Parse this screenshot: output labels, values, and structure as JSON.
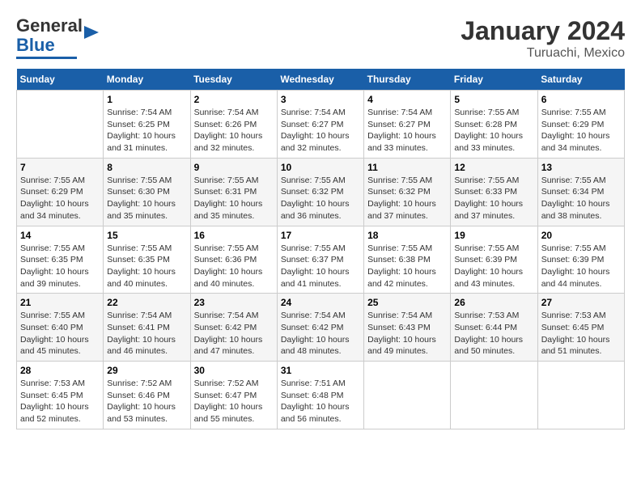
{
  "header": {
    "logo_line1": "General",
    "logo_line2": "Blue",
    "title": "January 2024",
    "subtitle": "Turuachi, Mexico"
  },
  "days_of_week": [
    "Sunday",
    "Monday",
    "Tuesday",
    "Wednesday",
    "Thursday",
    "Friday",
    "Saturday"
  ],
  "weeks": [
    [
      {
        "day": "",
        "info": ""
      },
      {
        "day": "1",
        "info": "Sunrise: 7:54 AM\nSunset: 6:25 PM\nDaylight: 10 hours\nand 31 minutes."
      },
      {
        "day": "2",
        "info": "Sunrise: 7:54 AM\nSunset: 6:26 PM\nDaylight: 10 hours\nand 32 minutes."
      },
      {
        "day": "3",
        "info": "Sunrise: 7:54 AM\nSunset: 6:27 PM\nDaylight: 10 hours\nand 32 minutes."
      },
      {
        "day": "4",
        "info": "Sunrise: 7:54 AM\nSunset: 6:27 PM\nDaylight: 10 hours\nand 33 minutes."
      },
      {
        "day": "5",
        "info": "Sunrise: 7:55 AM\nSunset: 6:28 PM\nDaylight: 10 hours\nand 33 minutes."
      },
      {
        "day": "6",
        "info": "Sunrise: 7:55 AM\nSunset: 6:29 PM\nDaylight: 10 hours\nand 34 minutes."
      }
    ],
    [
      {
        "day": "7",
        "info": "Sunrise: 7:55 AM\nSunset: 6:29 PM\nDaylight: 10 hours\nand 34 minutes."
      },
      {
        "day": "8",
        "info": "Sunrise: 7:55 AM\nSunset: 6:30 PM\nDaylight: 10 hours\nand 35 minutes."
      },
      {
        "day": "9",
        "info": "Sunrise: 7:55 AM\nSunset: 6:31 PM\nDaylight: 10 hours\nand 35 minutes."
      },
      {
        "day": "10",
        "info": "Sunrise: 7:55 AM\nSunset: 6:32 PM\nDaylight: 10 hours\nand 36 minutes."
      },
      {
        "day": "11",
        "info": "Sunrise: 7:55 AM\nSunset: 6:32 PM\nDaylight: 10 hours\nand 37 minutes."
      },
      {
        "day": "12",
        "info": "Sunrise: 7:55 AM\nSunset: 6:33 PM\nDaylight: 10 hours\nand 37 minutes."
      },
      {
        "day": "13",
        "info": "Sunrise: 7:55 AM\nSunset: 6:34 PM\nDaylight: 10 hours\nand 38 minutes."
      }
    ],
    [
      {
        "day": "14",
        "info": "Sunrise: 7:55 AM\nSunset: 6:35 PM\nDaylight: 10 hours\nand 39 minutes."
      },
      {
        "day": "15",
        "info": "Sunrise: 7:55 AM\nSunset: 6:35 PM\nDaylight: 10 hours\nand 40 minutes."
      },
      {
        "day": "16",
        "info": "Sunrise: 7:55 AM\nSunset: 6:36 PM\nDaylight: 10 hours\nand 40 minutes."
      },
      {
        "day": "17",
        "info": "Sunrise: 7:55 AM\nSunset: 6:37 PM\nDaylight: 10 hours\nand 41 minutes."
      },
      {
        "day": "18",
        "info": "Sunrise: 7:55 AM\nSunset: 6:38 PM\nDaylight: 10 hours\nand 42 minutes."
      },
      {
        "day": "19",
        "info": "Sunrise: 7:55 AM\nSunset: 6:39 PM\nDaylight: 10 hours\nand 43 minutes."
      },
      {
        "day": "20",
        "info": "Sunrise: 7:55 AM\nSunset: 6:39 PM\nDaylight: 10 hours\nand 44 minutes."
      }
    ],
    [
      {
        "day": "21",
        "info": "Sunrise: 7:55 AM\nSunset: 6:40 PM\nDaylight: 10 hours\nand 45 minutes."
      },
      {
        "day": "22",
        "info": "Sunrise: 7:54 AM\nSunset: 6:41 PM\nDaylight: 10 hours\nand 46 minutes."
      },
      {
        "day": "23",
        "info": "Sunrise: 7:54 AM\nSunset: 6:42 PM\nDaylight: 10 hours\nand 47 minutes."
      },
      {
        "day": "24",
        "info": "Sunrise: 7:54 AM\nSunset: 6:42 PM\nDaylight: 10 hours\nand 48 minutes."
      },
      {
        "day": "25",
        "info": "Sunrise: 7:54 AM\nSunset: 6:43 PM\nDaylight: 10 hours\nand 49 minutes."
      },
      {
        "day": "26",
        "info": "Sunrise: 7:53 AM\nSunset: 6:44 PM\nDaylight: 10 hours\nand 50 minutes."
      },
      {
        "day": "27",
        "info": "Sunrise: 7:53 AM\nSunset: 6:45 PM\nDaylight: 10 hours\nand 51 minutes."
      }
    ],
    [
      {
        "day": "28",
        "info": "Sunrise: 7:53 AM\nSunset: 6:45 PM\nDaylight: 10 hours\nand 52 minutes."
      },
      {
        "day": "29",
        "info": "Sunrise: 7:52 AM\nSunset: 6:46 PM\nDaylight: 10 hours\nand 53 minutes."
      },
      {
        "day": "30",
        "info": "Sunrise: 7:52 AM\nSunset: 6:47 PM\nDaylight: 10 hours\nand 55 minutes."
      },
      {
        "day": "31",
        "info": "Sunrise: 7:51 AM\nSunset: 6:48 PM\nDaylight: 10 hours\nand 56 minutes."
      },
      {
        "day": "",
        "info": ""
      },
      {
        "day": "",
        "info": ""
      },
      {
        "day": "",
        "info": ""
      }
    ]
  ]
}
